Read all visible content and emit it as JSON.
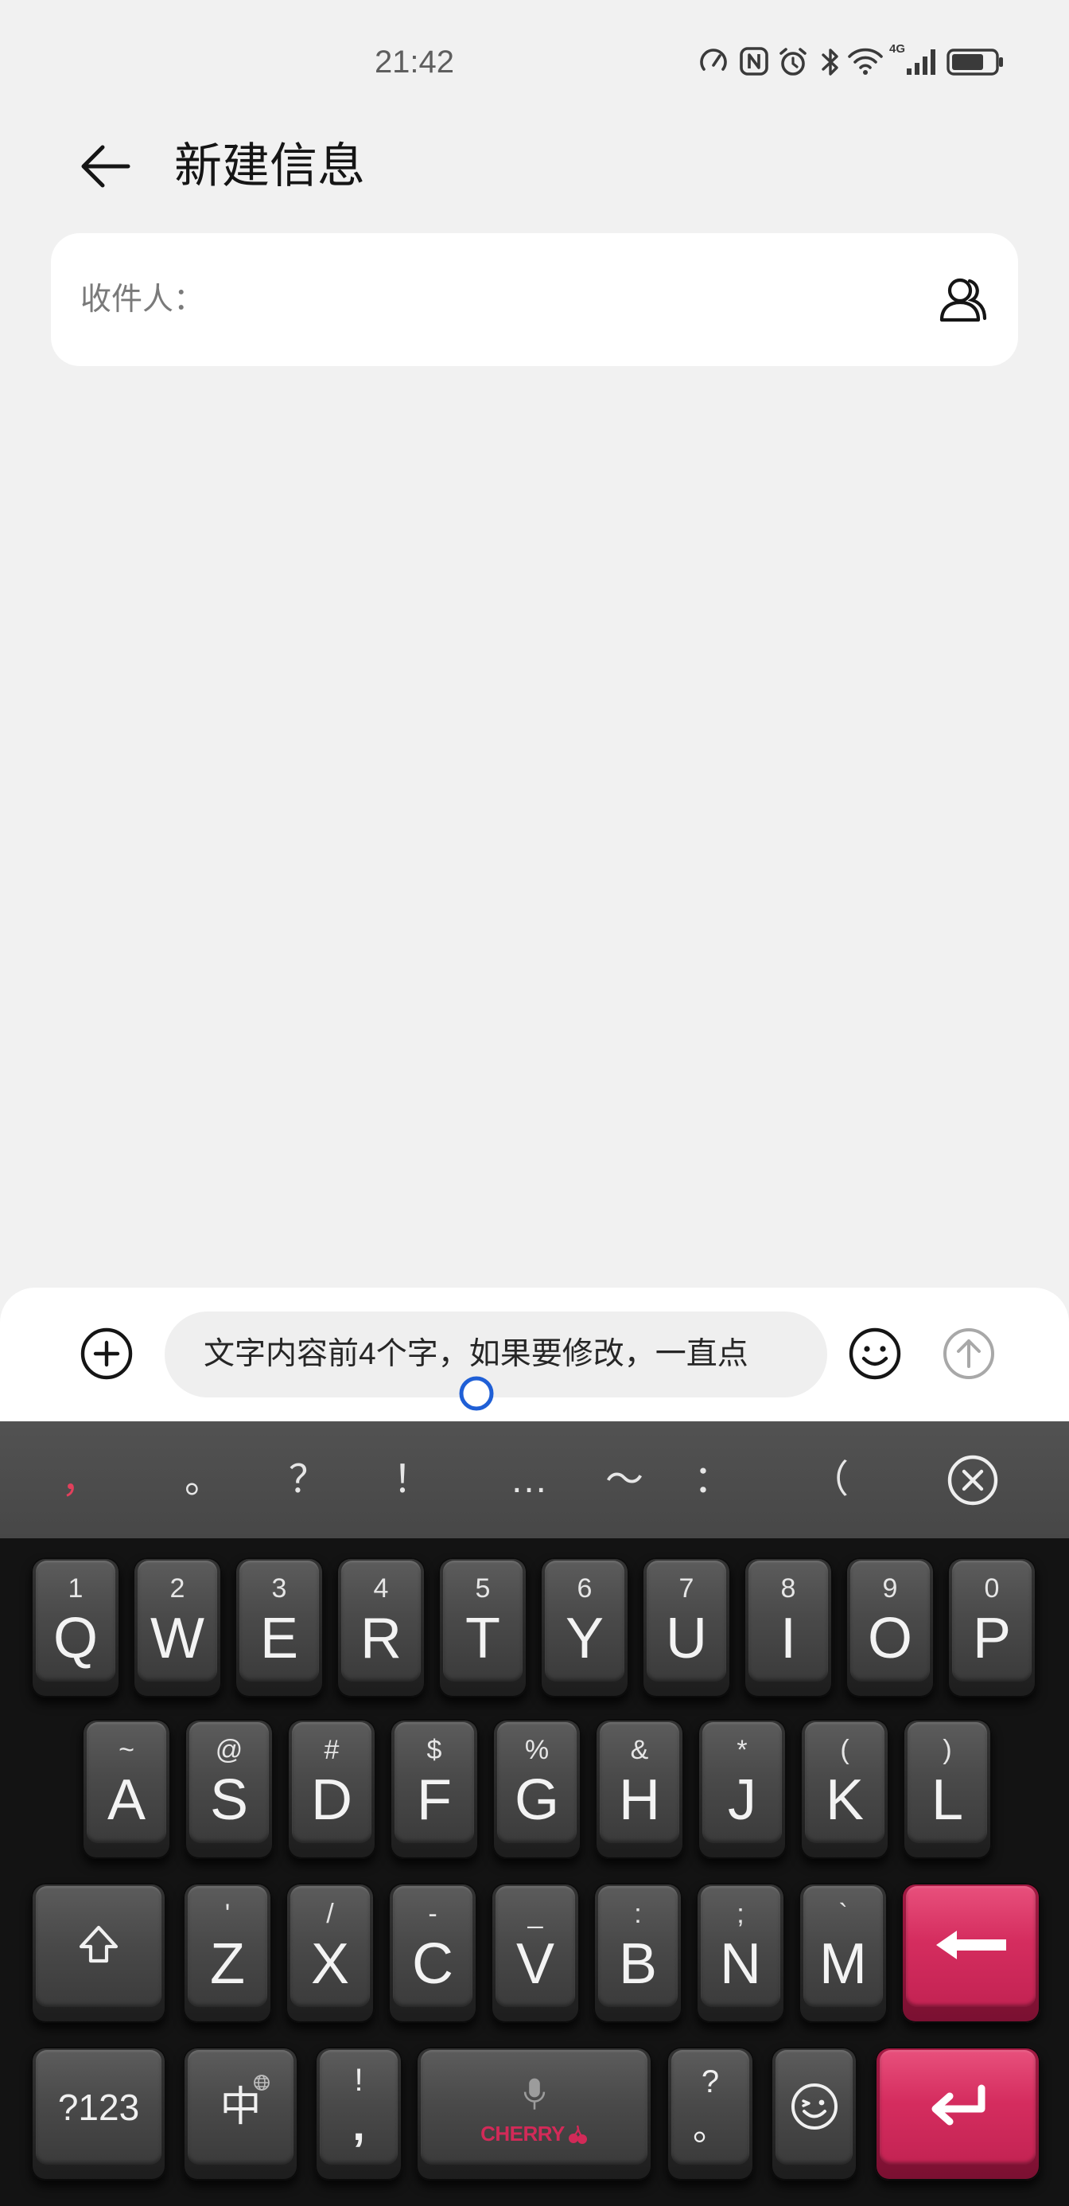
{
  "status_bar": {
    "time": "21:42",
    "network_type": "4G",
    "battery_level_percent": 75,
    "icons": [
      "speedometer-icon",
      "nfc-icon",
      "alarm-clock-icon",
      "bluetooth-icon",
      "wifi-icon",
      "cellular-signal-icon",
      "battery-icon"
    ]
  },
  "header": {
    "back_icon": "back-arrow-icon",
    "title": "新建信息"
  },
  "recipient": {
    "label": "收件人：",
    "contact_icon": "contacts-icon"
  },
  "compose": {
    "attach_icon": "add-circle-icon",
    "message_text": "文字内容前4个字，如果要修改，一直点",
    "emoji_icon": "emoji-icon",
    "send_icon": "send-arrow-icon"
  },
  "keyboard": {
    "candidates": [
      "，",
      "。",
      "？",
      "！",
      "…",
      "～",
      "：",
      "（"
    ],
    "clear_icon": "clear-circle-icon",
    "row1": [
      {
        "label": "Q",
        "hint": "1"
      },
      {
        "label": "W",
        "hint": "2"
      },
      {
        "label": "E",
        "hint": "3"
      },
      {
        "label": "R",
        "hint": "4"
      },
      {
        "label": "T",
        "hint": "5"
      },
      {
        "label": "Y",
        "hint": "6"
      },
      {
        "label": "U",
        "hint": "7"
      },
      {
        "label": "I",
        "hint": "8"
      },
      {
        "label": "O",
        "hint": "9"
      },
      {
        "label": "P",
        "hint": "0"
      }
    ],
    "row2": [
      {
        "label": "A",
        "hint": "~"
      },
      {
        "label": "S",
        "hint": "@"
      },
      {
        "label": "D",
        "hint": "#"
      },
      {
        "label": "F",
        "hint": "$"
      },
      {
        "label": "G",
        "hint": "%"
      },
      {
        "label": "H",
        "hint": "&"
      },
      {
        "label": "J",
        "hint": "*"
      },
      {
        "label": "K",
        "hint": "("
      },
      {
        "label": "L",
        "hint": ")"
      }
    ],
    "row3": [
      {
        "label": "Z",
        "hint": "'"
      },
      {
        "label": "X",
        "hint": "/"
      },
      {
        "label": "C",
        "hint": "-"
      },
      {
        "label": "V",
        "hint": "_"
      },
      {
        "label": "B",
        "hint": ":"
      },
      {
        "label": "N",
        "hint": ";"
      },
      {
        "label": "M",
        "hint": "`"
      }
    ],
    "row3_icons": {
      "shift": "shift-icon",
      "backspace": "backspace-icon"
    },
    "row4": {
      "mode_label": "?123",
      "language_label": "中",
      "globe_icon": "globe-icon",
      "punct_key_top": "!",
      "punct_key_bottom": ",",
      "space_mic_icon": "microphone-icon",
      "space_brand": "CHERRY",
      "punct2_key_top": "?",
      "punct2_key_bottom": "。",
      "emoji_icon": "emoji-key-icon",
      "enter_icon": "enter-icon"
    }
  },
  "colors": {
    "page_background": "#f1f1f1",
    "card_background": "#ffffff",
    "input_background": "#efefef",
    "cursor_handle": "#1f5fd6",
    "send_icon_inactive": "#a8a8a8",
    "candidate_bar": "#4b4b4b",
    "candidate_highlight": "#e2405c",
    "keyboard_background": "#131313",
    "keycap": "#4a4a4a",
    "accent_keycap": "#d42b5d",
    "brand_text": "#d22a58"
  }
}
